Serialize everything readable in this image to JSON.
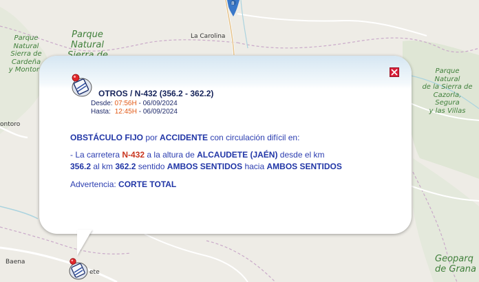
{
  "map": {
    "labels": {
      "park_cardena": "Parque\nNatural\nSierra de\nCardeña\ny Montoro",
      "park_andujar": "Parque\nNatural\nSierra de",
      "town_carolina": "La Carolina",
      "park_cazorla": "Parque\nNatural\nde la Sierra de\nCazorla,\nSegura\ny las Villas",
      "town_montoro": "ontoro",
      "town_baena": "Baena",
      "geopark": "Geoparq\nde Grana",
      "town_alcaudete": "ete"
    }
  },
  "popup": {
    "close_icon": "close-icon",
    "incident_icon": "road-works-icon",
    "title": "OTROS / N-432 (356.2 - 362.2)",
    "from_label": "Desde:",
    "from_time": "07:56H",
    "from_date": "- 06/09/2024",
    "to_label": "Hasta:",
    "to_time": "12:45H",
    "to_date": "- 06/09/2024",
    "summary_part1": "OBSTÁCULO FIJO",
    "summary_part2": " por ",
    "summary_part3": "ACCIDENTE",
    "summary_part4": " con circulación difícil en:",
    "detail_part1": "- La carretera ",
    "detail_road": "N-432",
    "detail_part2": " a la altura de ",
    "detail_place": "ALCAUDETE (JAÉN)",
    "detail_part3": " desde el km",
    "detail_line2_part1": "356.2",
    "detail_line2_part2": " al km ",
    "detail_line2_part3": "362.2",
    "detail_line2_part4": " sentido ",
    "detail_line2_part5": "AMBOS SENTIDOS",
    "detail_line2_part6": " hacia ",
    "detail_line2_part7": "AMBOS SENTIDOS",
    "warning_label": "Advertencia: ",
    "warning_value": "CORTE TOTAL"
  },
  "colors": {
    "map_background": "#eeece6",
    "park_green": "#3f7f3a",
    "text_blue": "#2b3db0",
    "accent_red": "#c8351f",
    "time_orange": "#e25a17"
  }
}
